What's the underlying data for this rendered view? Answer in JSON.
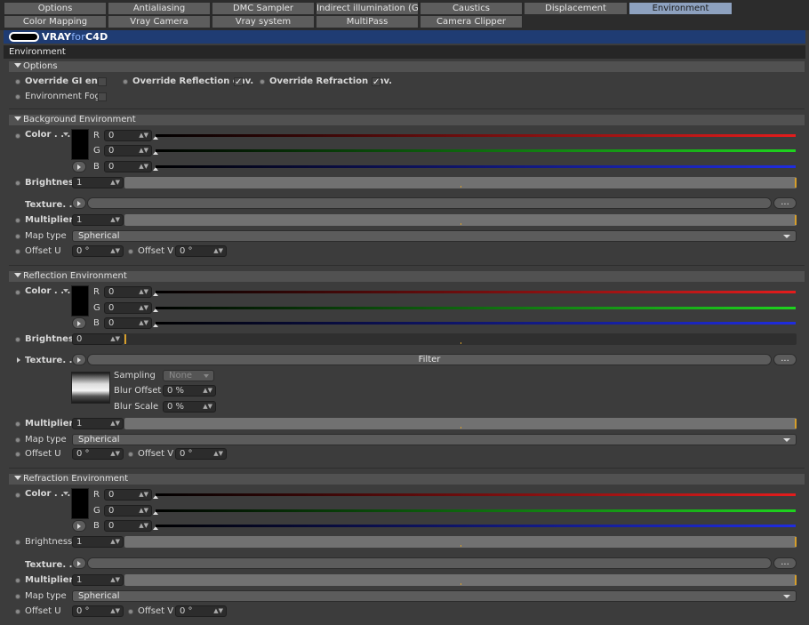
{
  "tabs": {
    "row1": [
      "Options",
      "Antialiasing",
      "DMC Sampler",
      "Indirect illumination (GI)",
      "Caustics",
      "Displacement",
      "Environment"
    ],
    "row2": [
      "Color Mapping",
      "Vray Camera",
      "Vray system",
      "MultiPass",
      "Camera Clipper"
    ],
    "active": "Environment"
  },
  "brand": {
    "name_a": "VRAY",
    "name_b": "for",
    "name_c": "C4D"
  },
  "panel_title": "Environment",
  "options": {
    "header": "Options",
    "override_gi": {
      "label": "Override GI env.",
      "checked": false
    },
    "override_reflection": {
      "label": "Override Reflection env.",
      "checked": true
    },
    "override_refraction": {
      "label": "Override Refraction env.",
      "checked": true
    },
    "environment_fog": {
      "label": "Environment Fog",
      "checked": false
    }
  },
  "labels": {
    "color": "Color . . .",
    "r": "R",
    "g": "G",
    "b": "B",
    "brightness": "Brightness",
    "texture": "Texture. . .",
    "multiplier": "Multiplier",
    "map_type": "Map type",
    "offset_u": "Offset U",
    "offset_v": "Offset V",
    "sampling": "Sampling",
    "blur_offset": "Blur Offset",
    "blur_scale": "Blur Scale",
    "dots": "...",
    "check": "✓"
  },
  "background": {
    "header": "Background Environment",
    "color": "#000000",
    "r": "0",
    "g": "0",
    "b": "0",
    "brightness": "1",
    "brightness_level": 1,
    "multiplier": "1",
    "multiplier_level": 1,
    "map_type": "Spherical",
    "offset_u": "0 °",
    "offset_v": "0 °"
  },
  "reflection": {
    "header": "Reflection Environment",
    "color": "#000000",
    "r": "0",
    "g": "0",
    "b": "0",
    "brightness": "0",
    "brightness_level": 0,
    "texture": "Filter",
    "sampling": "None",
    "blur_offset": "0 %",
    "blur_scale": "0 %",
    "multiplier": "1",
    "multiplier_level": 1,
    "map_type": "Spherical",
    "offset_u": "0 °",
    "offset_v": "0 °"
  },
  "refraction": {
    "header": "Refraction Environment",
    "color": "#000000",
    "r": "0",
    "g": "0",
    "b": "0",
    "brightness": "1",
    "brightness_level": 1,
    "multiplier": "1",
    "multiplier_level": 1,
    "map_type": "Spherical",
    "offset_u": "0 °",
    "offset_v": "0 °"
  },
  "colors": {
    "red": "#e41c1c",
    "green": "#1ed41e",
    "blue": "#1f2ce0",
    "accent": "#d69e2a",
    "active_tab": "#8da1bf"
  }
}
